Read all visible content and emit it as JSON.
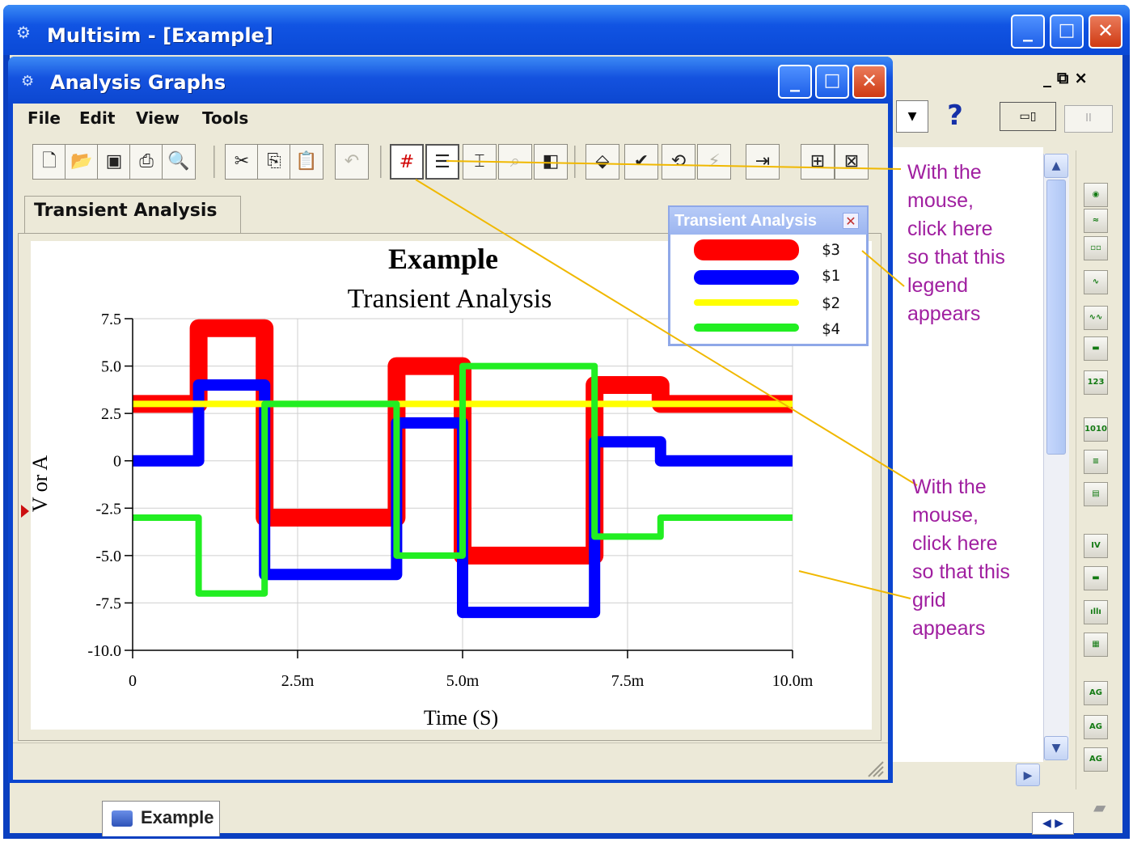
{
  "main_window": {
    "title": "Multisim - [Example]",
    "buttons": {
      "minimize": "_",
      "maximize": "□",
      "close": "✕"
    },
    "mdi_controls": "_ ⧉ ×",
    "help_glyph": "?",
    "bottom_tab": "Example"
  },
  "analysis_window": {
    "title": "Analysis Graphs",
    "menu": [
      "File",
      "Edit",
      "View",
      "Tools"
    ],
    "tab": "Transient Analysis"
  },
  "chart_data": {
    "type": "line",
    "title": "Example",
    "subtitle": "Transient Analysis",
    "xlabel": "Time (S)",
    "ylabel": "V or A",
    "xlim": [
      0,
      0.01
    ],
    "ylim": [
      -10.0,
      7.5
    ],
    "x_ticks": [
      "0",
      "2.5m",
      "5.0m",
      "7.5m",
      "10.0m"
    ],
    "y_ticks": [
      "7.5",
      "5.0",
      "2.5",
      "0",
      "-2.5",
      "-5.0",
      "-7.5",
      "-10.0"
    ],
    "grid": true,
    "legend_placement": "top-right",
    "series": [
      {
        "name": "$3",
        "color": "#ff0000",
        "x": [
          0,
          0.001,
          0.001,
          0.002,
          0.002,
          0.004,
          0.004,
          0.005,
          0.005,
          0.007,
          0.007,
          0.008,
          0.008,
          0.01
        ],
        "y": [
          3,
          3,
          7,
          7,
          -3,
          -3,
          5,
          5,
          -5,
          -5,
          4,
          4,
          3,
          3
        ]
      },
      {
        "name": "$1",
        "color": "#0000ff",
        "x": [
          0,
          0.001,
          0.001,
          0.002,
          0.002,
          0.004,
          0.004,
          0.005,
          0.005,
          0.007,
          0.007,
          0.008,
          0.008,
          0.01
        ],
        "y": [
          0,
          0,
          4,
          4,
          -6,
          -6,
          2,
          2,
          -8,
          -8,
          1,
          1,
          0,
          0
        ]
      },
      {
        "name": "$2",
        "color": "#ffff00",
        "x": [
          0,
          0.01
        ],
        "y": [
          3,
          3
        ]
      },
      {
        "name": "$4",
        "color": "#00ff00",
        "x": [
          0,
          0.001,
          0.001,
          0.002,
          0.002,
          0.004,
          0.004,
          0.005,
          0.005,
          0.007,
          0.007,
          0.008,
          0.008,
          0.01
        ],
        "y": [
          -3,
          -3,
          -7,
          -7,
          3,
          3,
          -5,
          -5,
          5,
          5,
          -4,
          -4,
          -3,
          -3
        ]
      }
    ]
  },
  "legend": {
    "title": "Transient Analysis",
    "close_glyph": "✕",
    "items": [
      "$3",
      "$1",
      "$2",
      "$4"
    ]
  },
  "callouts": {
    "legend_note": [
      "With the",
      "mouse,",
      "click here",
      "so that this",
      "legend",
      "appears"
    ],
    "grid_note": [
      "With the",
      "mouse,",
      "click here",
      "so that this",
      "grid",
      "appears"
    ]
  }
}
